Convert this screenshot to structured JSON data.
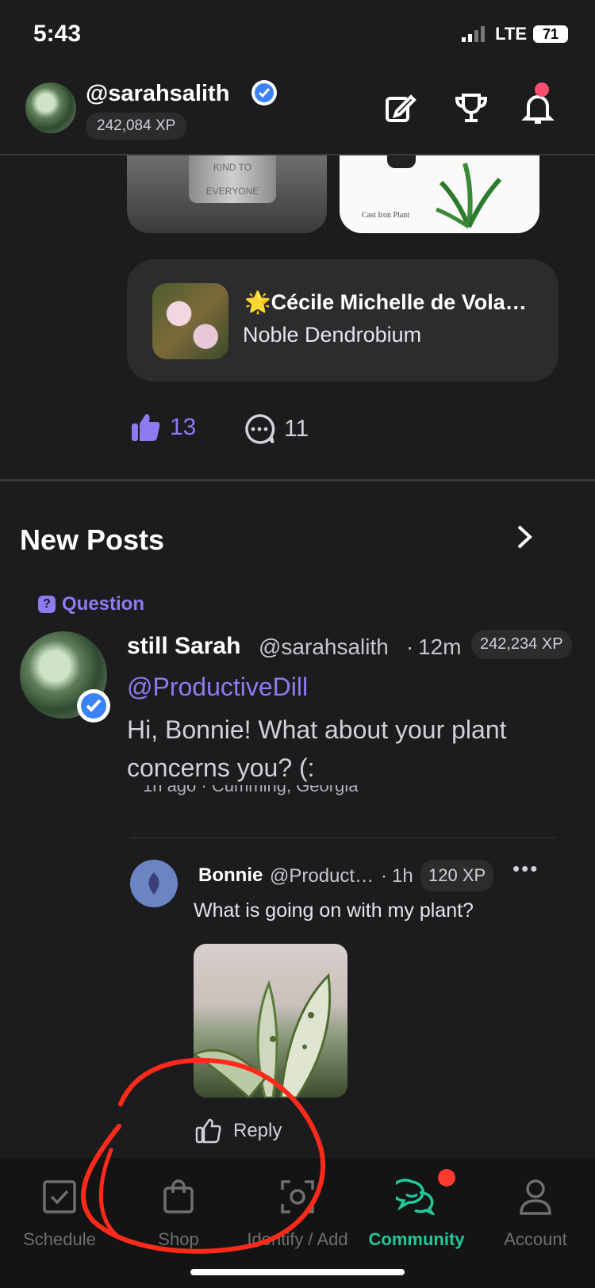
{
  "status_bar": {
    "time": "5:43",
    "network": "LTE",
    "battery": "71"
  },
  "header": {
    "username": "@sarahsalith",
    "xp": "242,084 XP"
  },
  "feed_card": {
    "images": [
      {
        "name": "kind-pot-image",
        "caption": "KIND TO EVERYONE"
      },
      {
        "name": "cast-iron-plant-image",
        "caption": "Cast Iron Plant"
      }
    ],
    "plant": {
      "name": "🌟Cécile Michelle de Vola…",
      "species": "Noble Dendrobium"
    },
    "likes": "13",
    "comments": "11"
  },
  "new_posts": {
    "title": "New Posts",
    "tag": "Question",
    "post": {
      "author": "still Sarah",
      "handle": "@sarahsalith",
      "separator": "·",
      "time": "12m",
      "xp": "242,234 XP",
      "mention": "@ProductiveDill",
      "body": "Hi, Bonnie! What about your plant concerns you? (:"
    },
    "peek_line": "1h ago  ·  Cumming, Georgia",
    "reply": {
      "name": "Bonnie",
      "handle": "@Product…",
      "separator": "·",
      "time": "1h",
      "xp": "120 XP",
      "more": "•••",
      "body": "What is going on with my plant?",
      "action_label": "Reply"
    }
  },
  "tabbar": {
    "tabs": [
      {
        "label": "Schedule",
        "icon": "calendar-check-icon"
      },
      {
        "label": "Shop",
        "icon": "shopping-bag-icon"
      },
      {
        "label": "Identify / Add",
        "icon": "camera-scan-icon"
      },
      {
        "label": "Community",
        "icon": "chat-bubbles-icon"
      },
      {
        "label": "Account",
        "icon": "person-icon"
      }
    ],
    "active": "Community"
  },
  "colors": {
    "accent": "#8e7bf0",
    "community": "#22c99a",
    "annotation": "#ff2a1a"
  }
}
